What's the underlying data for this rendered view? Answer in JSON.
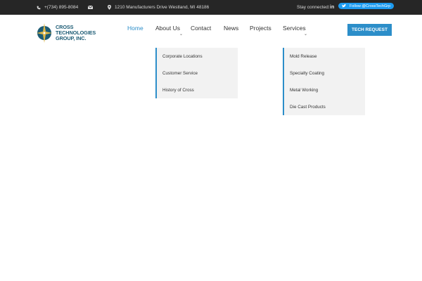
{
  "topbar": {
    "phone": "+(734) 895-8084",
    "address": "1210 Manufacturers Drive Westland, MI 48186",
    "stay_connected": "Stay connected:",
    "linkedin": "in",
    "follow": "Follow @CrossTechGrp"
  },
  "logo": {
    "line1": "CROSS",
    "line2": "TECHNOLOGIES",
    "line3": "GROUP, INC."
  },
  "nav": {
    "home": "Home",
    "about": "About Us",
    "contact": "Contact",
    "news": "News",
    "projects": "Projects",
    "services": "Services",
    "tech_request": "TECH REQUEST"
  },
  "about_menu": [
    "Corporate Locations",
    "Customer Service",
    "History of Cross"
  ],
  "services_menu": [
    "Mold Release",
    "Specialty Coating",
    "Metal Working",
    "Die Cast Products"
  ],
  "colors": {
    "accent": "#2c8ec9",
    "topbar": "#262626",
    "twitter": "#1d9bf0",
    "logo_text": "#1d5c75"
  }
}
